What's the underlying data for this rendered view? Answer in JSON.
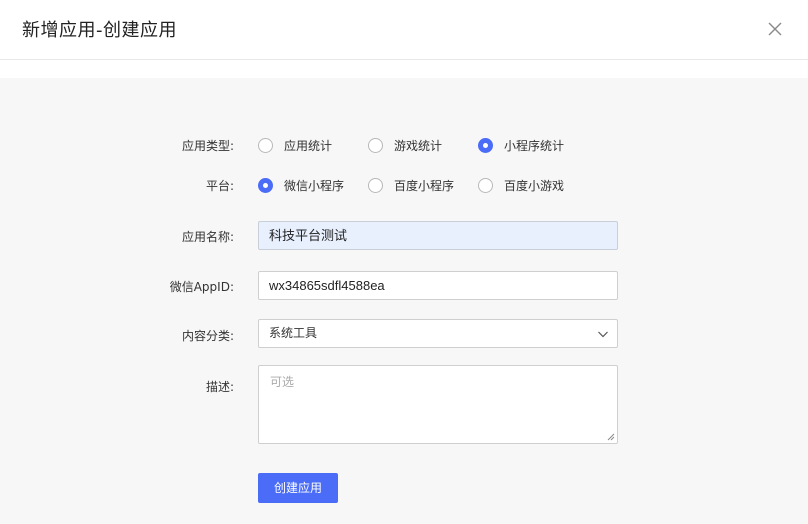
{
  "dialog": {
    "title": "新增应用-创建应用"
  },
  "form": {
    "app_type": {
      "label": "应用类型:",
      "options": [
        "应用统计",
        "游戏统计",
        "小程序统计"
      ],
      "selected": "小程序统计"
    },
    "platform": {
      "label": "平台:",
      "options": [
        "微信小程序",
        "百度小程序",
        "百度小游戏"
      ],
      "selected": "微信小程序"
    },
    "app_name": {
      "label": "应用名称:",
      "value": "科技平台测试"
    },
    "wechat_appid": {
      "label": "微信AppID:",
      "value": "wx34865sdfl4588ea"
    },
    "category": {
      "label": "内容分类:",
      "value": "系统工具"
    },
    "description": {
      "label": "描述:",
      "placeholder": "可选",
      "value": ""
    },
    "submit_label": "创建应用"
  },
  "colors": {
    "accent": "#4a6cf7",
    "body_bg": "#f7f7f8",
    "autofill_bg": "#e8f0fe"
  },
  "icons": {
    "close": "close-icon",
    "select_arrow": "chevron-down-icon",
    "resize": "resize-grip-icon"
  }
}
